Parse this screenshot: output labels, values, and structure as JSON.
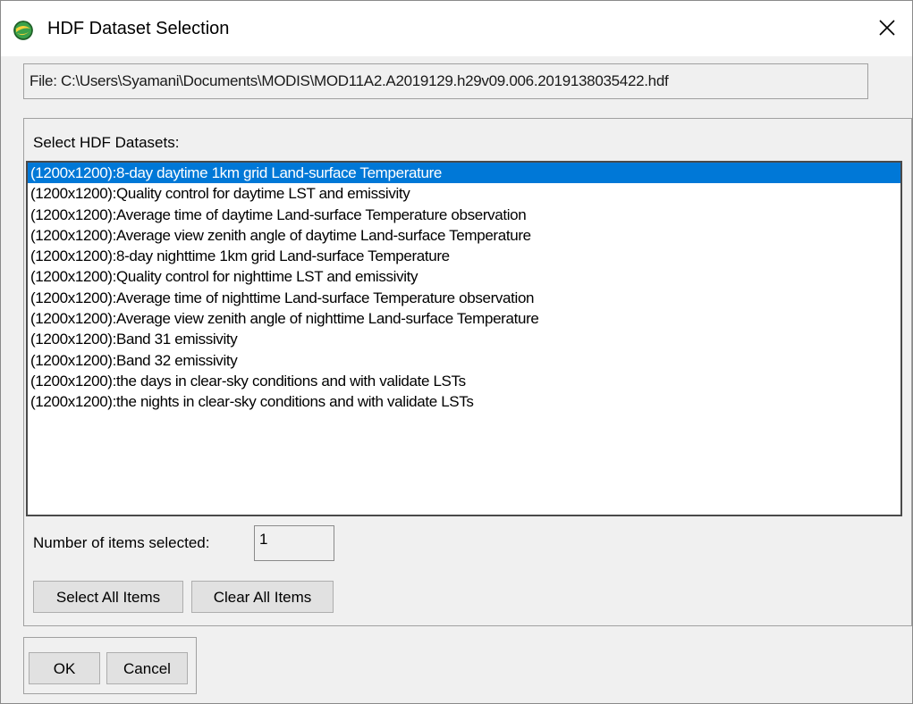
{
  "window": {
    "title": "HDF Dataset Selection",
    "icon": "globe-app-icon",
    "close_glyph": "✕"
  },
  "file": {
    "label": "File: C:\\Users\\Syamani\\Documents\\MODIS\\MOD11A2.A2019129.h29v09.006.2019138035422.hdf"
  },
  "datasets": {
    "label": "Select HDF Datasets:",
    "items": [
      "(1200x1200):8-day daytime 1km grid Land-surface Temperature",
      "(1200x1200):Quality control for daytime LST and emissivity",
      "(1200x1200):Average time of daytime Land-surface Temperature observation",
      "(1200x1200):Average view zenith angle of daytime Land-surface Temperature",
      "(1200x1200):8-day nighttime 1km grid Land-surface Temperature",
      "(1200x1200):Quality control for nighttime LST and emissivity",
      "(1200x1200):Average time of nighttime Land-surface Temperature observation",
      "(1200x1200):Average view zenith angle of nighttime Land-surface Temperature",
      "(1200x1200):Band 31 emissivity",
      "(1200x1200):Band 32 emissivity",
      "(1200x1200):the days in clear-sky conditions and with validate LSTs",
      "(1200x1200):the nights in clear-sky conditions and with validate LSTs"
    ],
    "selected_index": 0,
    "selected_color": "#0078d7"
  },
  "selection": {
    "count_label": "Number of items selected:",
    "count_value": "1"
  },
  "buttons": {
    "select_all": "Select All Items",
    "clear_all": "Clear All Items",
    "ok": "OK",
    "cancel": "Cancel"
  }
}
